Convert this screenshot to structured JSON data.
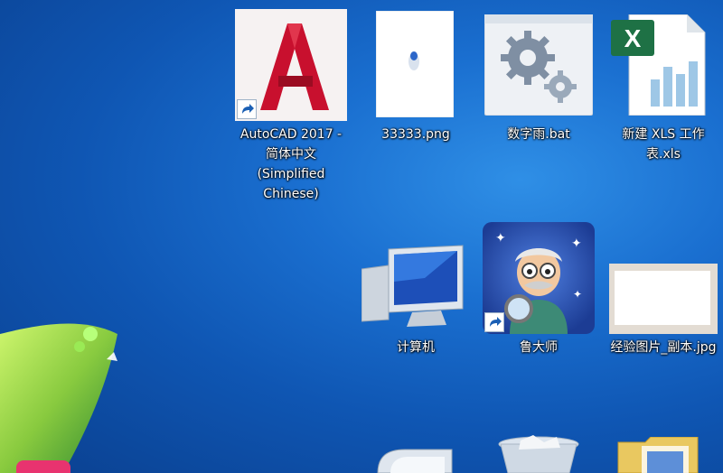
{
  "desktop": {
    "icons": [
      {
        "id": "autocad",
        "label": "AutoCAD 2017 - 简体中文 (Simplified Chinese)",
        "icon": "autocad-icon",
        "shortcut": true
      },
      {
        "id": "png",
        "label": "33333.png",
        "icon": "image-file-icon",
        "shortcut": false
      },
      {
        "id": "bat",
        "label": "数字雨.bat",
        "icon": "gear-icon",
        "shortcut": false
      },
      {
        "id": "xls",
        "label": "新建 XLS 工作表.xls",
        "icon": "excel-file-icon",
        "shortcut": false
      },
      {
        "id": "computer",
        "label": "计算机",
        "icon": "computer-icon",
        "shortcut": false
      },
      {
        "id": "ludashi",
        "label": "鲁大师",
        "icon": "ludashi-icon",
        "shortcut": true
      },
      {
        "id": "jpg",
        "label": "经验图片_副本.jpg",
        "icon": "image-file-icon",
        "shortcut": false
      }
    ]
  },
  "colors": {
    "background": "#1a6fd0",
    "autocad_red": "#c8102e",
    "excel_green": "#1e7145"
  }
}
